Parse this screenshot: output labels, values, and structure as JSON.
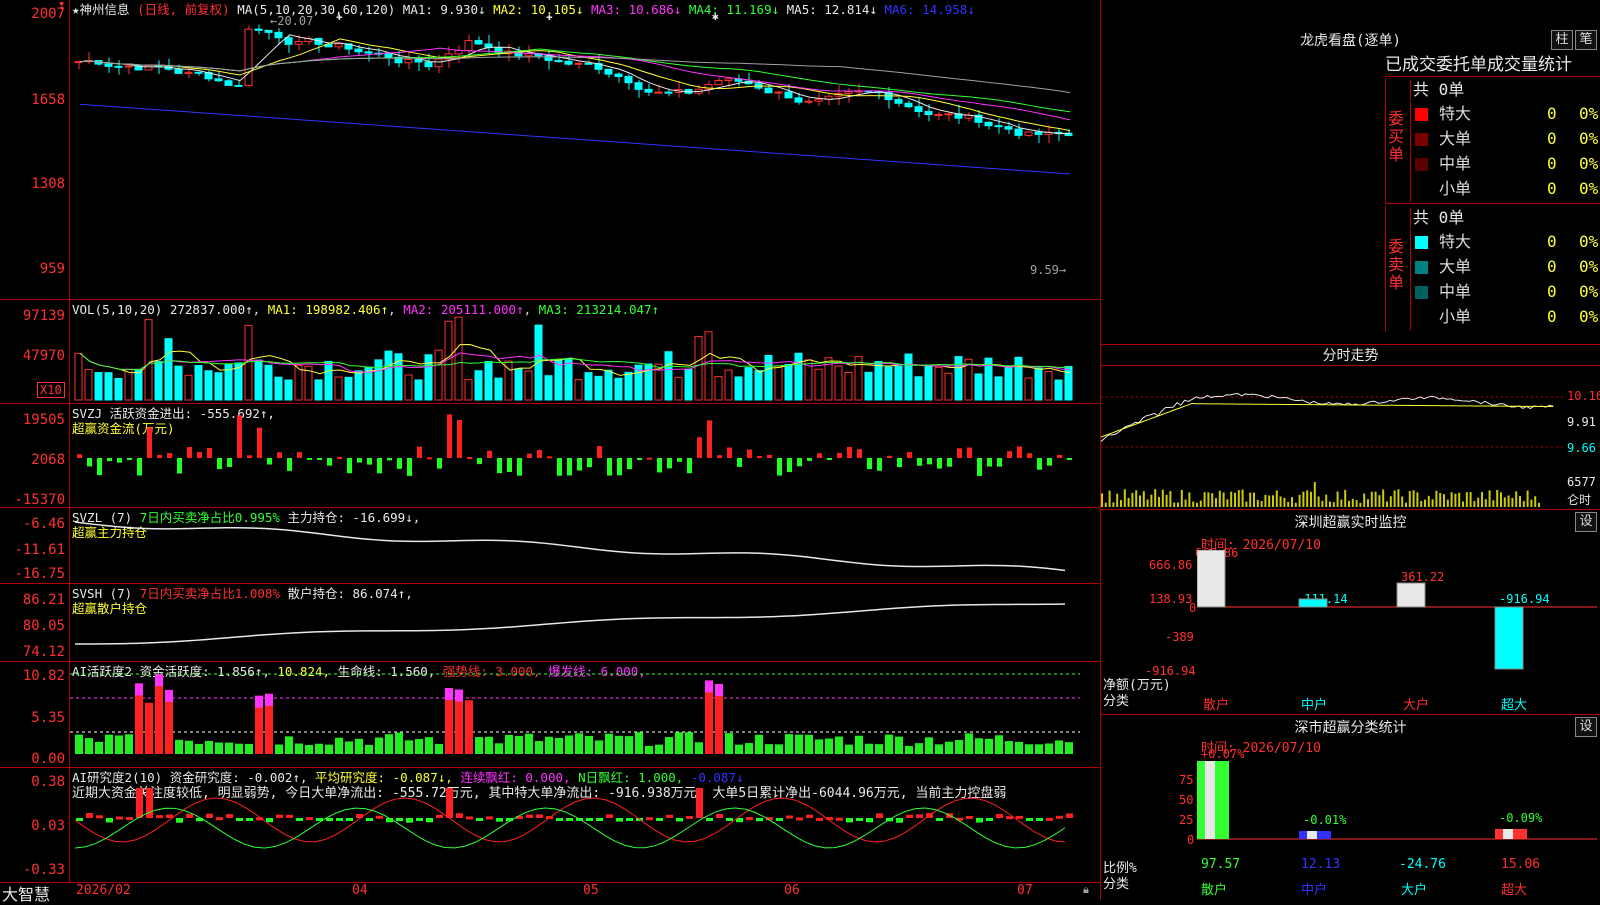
{
  "main": {
    "stock_name": "神州信息",
    "period": "(日线, 前复权)",
    "ma_label": "MA(5,10,20,30,60,120)",
    "ma1": "MA1: 9.930↓",
    "ma2": "MA2: 10.105↓",
    "ma3": "MA3: 10.686↓",
    "ma4": "MA4: 11.169↓",
    "ma5": "MA5: 12.814↓",
    "ma6": "MA6: 14.958↓",
    "high_mark": "←20.07",
    "low_mark": "9.59→",
    "y_ticks": [
      "2007",
      "1658",
      "1308",
      "959"
    ]
  },
  "vol": {
    "label": "VOL(5,10,20)",
    "value": "272837.000↑",
    "ma1": "MA1: 198982.406↑",
    "ma2": "MA2: 205111.000↑",
    "ma3": "MA3: 213214.047↑",
    "y_ticks": [
      "97139",
      "47970"
    ],
    "unit": "X10"
  },
  "svzj": {
    "label": "SVZJ",
    "value": "活跃资金进出: -555.692↑,",
    "sub": "超赢资金流(万元)",
    "y_ticks": [
      "19505",
      "2068",
      "-15370"
    ]
  },
  "svzl": {
    "label": "SVZL (7)",
    "rate": "7日内买卖净占比0.995%",
    "value": "主力持仓: -16.699↓,",
    "sub": "超赢主力持仓",
    "y_ticks": [
      "-6.46",
      "-11.61",
      "-16.75"
    ]
  },
  "svsh": {
    "label": "SVSH (7)",
    "rate": "7日内买卖净占比1.008%",
    "value": "散户持仓: 86.074↑,",
    "sub": "超赢散户持仓",
    "y_ticks": [
      "86.21",
      "80.05",
      "74.12"
    ]
  },
  "ai_active": {
    "label": "AI活跃度2",
    "v1": "资金活跃度: 1.856↑,",
    "v2": "10.824,",
    "v3": "生命线: 1.560,",
    "v4": "强势线: 3.000,",
    "v5": "爆发线: 6.000,",
    "y_ticks": [
      "10.82",
      "5.35",
      "0.00"
    ]
  },
  "ai_research": {
    "label": "AI研究度2(10)",
    "v1": "资金研究度: -0.002↑,",
    "v2": "平均研究度: -0.087↓,",
    "v3": "连续飘红: 0.000,",
    "v4": "N日飘红: 1.000,",
    "v5": "-0.087↓",
    "comment": "近期大资金关注度较低, 明显弱势, 今日大单净流出: -555.72万元, 其中特大单净流出: -916.938万元, 大单5日累计净出-6044.96万元, 当前主力控盘弱",
    "y_ticks": [
      "0.38",
      "0.03",
      "-0.33"
    ]
  },
  "xaxis": {
    "brand": "大智慧",
    "labels": [
      "2026/02",
      "04",
      "05",
      "06",
      "07"
    ]
  },
  "longhu": {
    "title": "龙虎看盘(逐单)",
    "btn1": "柱",
    "btn2": "笔",
    "subtitle": "已成交委托单成交量统计",
    "buy_side": "委买单",
    "sell_side": "委卖单",
    "buy_total": "共 0单",
    "sell_total": "共 0单",
    "buy_rows": [
      {
        "name": "特大",
        "count": "0",
        "pct": "0%"
      },
      {
        "name": "大单",
        "count": "0",
        "pct": "0%"
      },
      {
        "name": "中单",
        "count": "0",
        "pct": "0%"
      },
      {
        "name": "小单",
        "count": "0",
        "pct": "0%"
      }
    ],
    "sell_rows": [
      {
        "name": "特大",
        "count": "0",
        "pct": "0%"
      },
      {
        "name": "大单",
        "count": "0",
        "pct": "0%"
      },
      {
        "name": "中单",
        "count": "0",
        "pct": "0%"
      },
      {
        "name": "小单",
        "count": "0",
        "pct": "0%"
      }
    ]
  },
  "intraday": {
    "title": "分时走势",
    "y_ticks": [
      "10.16",
      "9.91",
      "9.66"
    ],
    "vol_label": "6577",
    "vol_unit": "仑时"
  },
  "sz_monitor": {
    "title": "深圳超赢实时监控",
    "btn": "设",
    "time": "时间: 2026/07/10",
    "y_ticks": [
      "666.86",
      "138.93",
      "0",
      "-389",
      "-916.94"
    ],
    "y_unit1": "净额(万元)",
    "y_unit2": "分类",
    "bars": [
      {
        "name": "散户",
        "value": "666.86"
      },
      {
        "name": "中户",
        "value": "-111.14"
      },
      {
        "name": "大户",
        "value": "361.22"
      },
      {
        "name": "超大",
        "value": "-916.94"
      }
    ]
  },
  "sz_class": {
    "title": "深市超赢分类统计",
    "btn": "设",
    "time": "时间: 2026/07/10",
    "y_ticks": [
      "75",
      "50",
      "25",
      "0"
    ],
    "y_unit1": "比例%",
    "y_unit2": "分类",
    "bars": [
      {
        "name": "散户",
        "delta": "+0.07%",
        "value": "97.57"
      },
      {
        "name": "中户",
        "delta": "-0.01%",
        "value": "12.13"
      },
      {
        "name": "大户",
        "delta": "",
        "value": "-24.76"
      },
      {
        "name": "超大",
        "delta": "-0.09%",
        "value": "15.06"
      }
    ]
  }
}
